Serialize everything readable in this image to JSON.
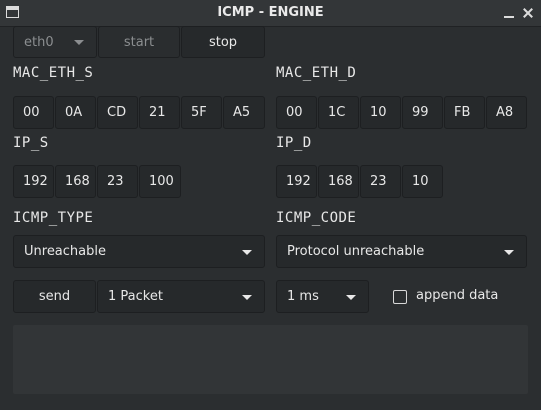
{
  "window": {
    "title": "ICMP - ENGINE"
  },
  "toolbar": {
    "interface": "eth0",
    "start_label": "start",
    "stop_label": "stop"
  },
  "mac_src": {
    "label": "MAC_ETH_S",
    "octets": [
      "00",
      "0A",
      "CD",
      "21",
      "5F",
      "A5"
    ]
  },
  "mac_dst": {
    "label": "MAC_ETH_D",
    "octets": [
      "00",
      "1C",
      "10",
      "99",
      "FB",
      "A8"
    ]
  },
  "ip_src": {
    "label": "IP_S",
    "octets": [
      "192",
      "168",
      "23",
      "100"
    ]
  },
  "ip_dst": {
    "label": "IP_D",
    "octets": [
      "192",
      "168",
      "23",
      "10"
    ]
  },
  "icmp_type": {
    "label": "ICMP_TYPE",
    "value": "Unreachable"
  },
  "icmp_code": {
    "label": "ICMP_CODE",
    "value": "Protocol unreachable"
  },
  "send": {
    "label": "send",
    "count": "1 Packet",
    "interval": "1 ms",
    "append_label": "append data",
    "append_checked": false
  },
  "output": {
    "text": ""
  }
}
